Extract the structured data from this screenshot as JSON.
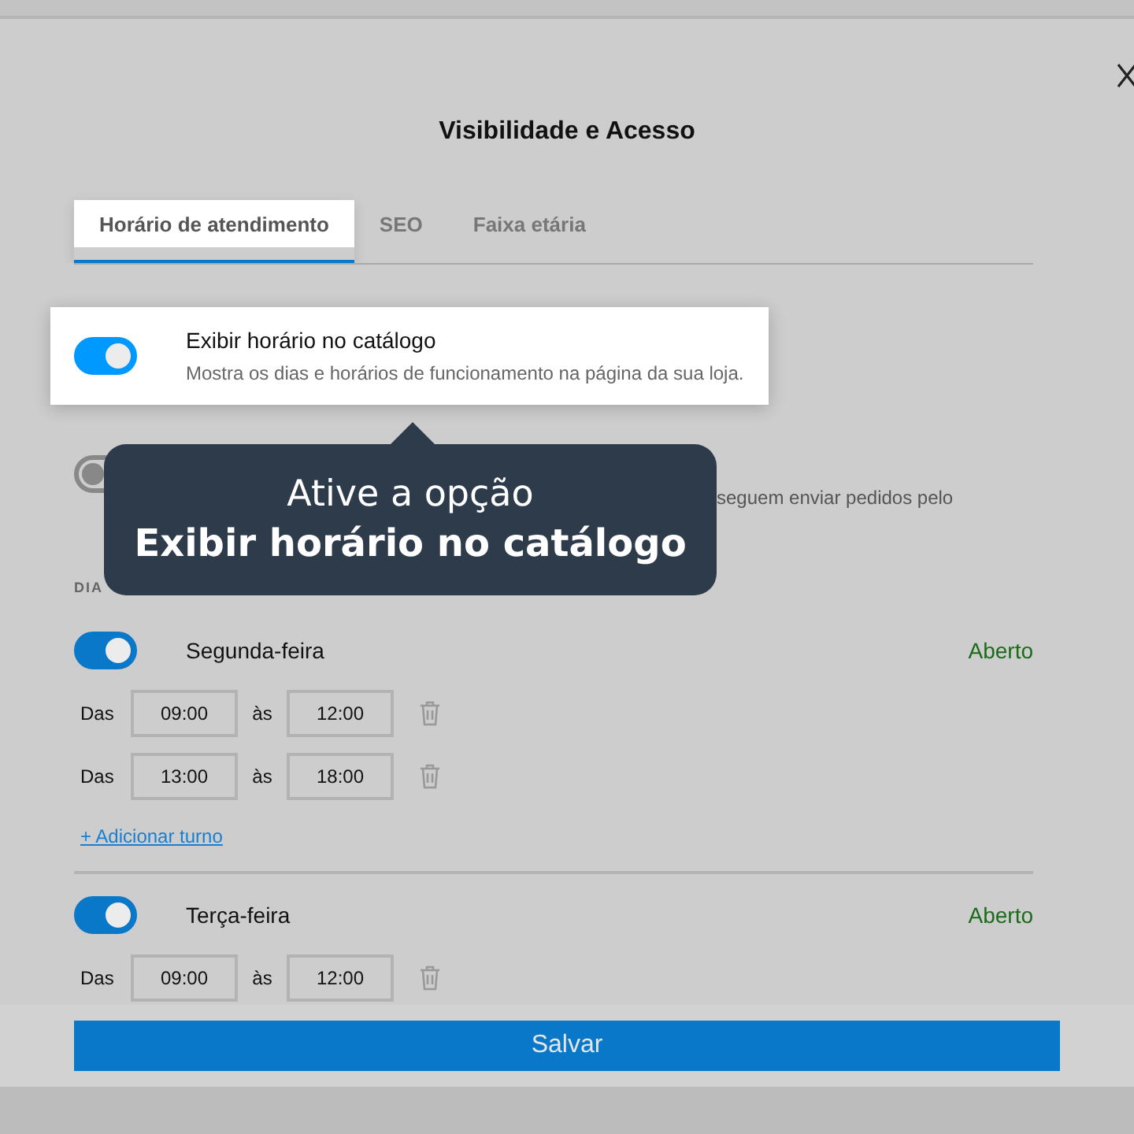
{
  "dialog": {
    "title": "Visibilidade e Acesso"
  },
  "tabs": [
    {
      "label": "Horário de atendimento",
      "selected": true
    },
    {
      "label": "SEO",
      "selected": false
    },
    {
      "label": "Faixa etária",
      "selected": false
    }
  ],
  "options": [
    {
      "label": "Exibir horário no catálogo",
      "description": "Mostra os dias e horários de funcionamento na página da sua loja.",
      "on": true,
      "highlighted": true
    },
    {
      "description": "seguem enviar pedidos pelo",
      "on": false,
      "highlighted": false
    }
  ],
  "tooltip": {
    "line_1": "Ative a opção",
    "line_2": "Exibir horário no catálogo"
  },
  "section_label": "DIA",
  "days": [
    {
      "name": "Segunda-feira",
      "on": true,
      "status": "Aberto",
      "shifts": [
        {
          "from_label": "Das",
          "from": "09:00",
          "to_label": "às",
          "to": "12:00"
        },
        {
          "from_label": "Das",
          "from": "13:00",
          "to_label": "às",
          "to": "18:00"
        }
      ],
      "add_link": "+ Adicionar turno"
    },
    {
      "name": "Terça-feira",
      "on": true,
      "status": "Aberto",
      "shifts": [
        {
          "from_label": "Das",
          "from": "09:00",
          "to_label": "às",
          "to": "12:00"
        }
      ]
    }
  ],
  "save_button": "Salvar"
}
